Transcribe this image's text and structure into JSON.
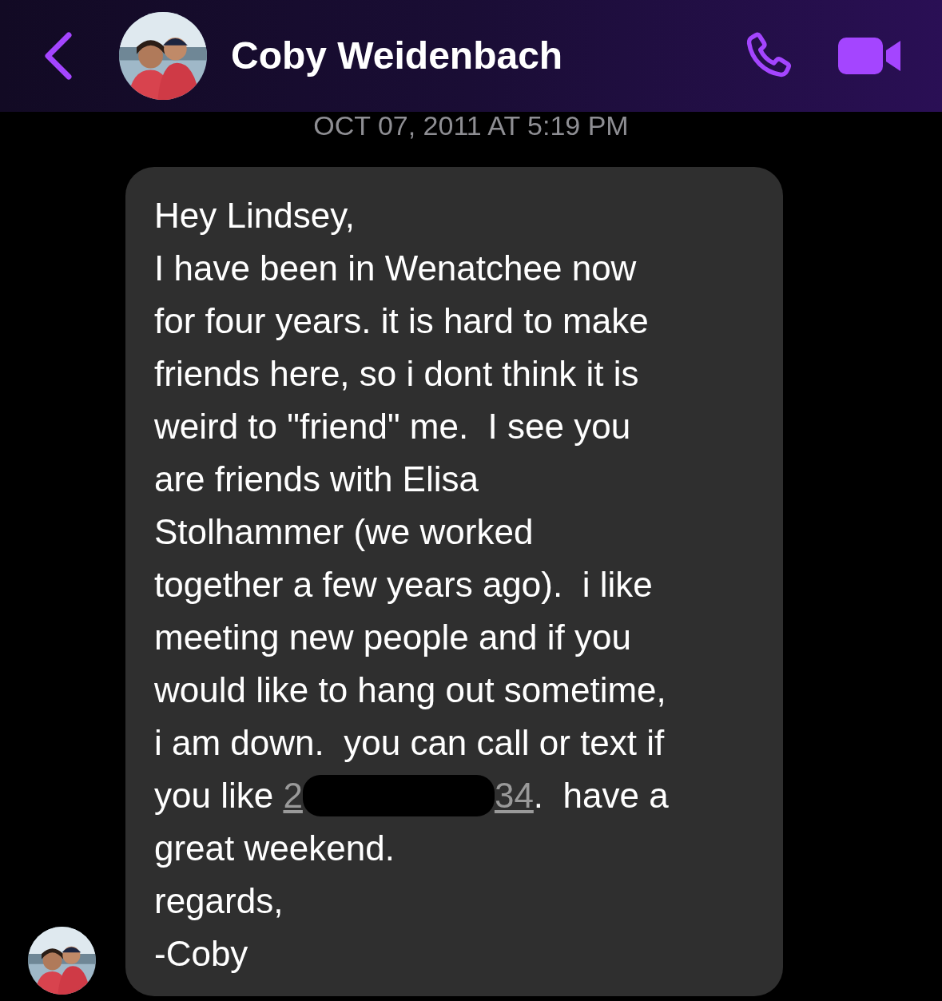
{
  "header": {
    "contact_name": "Coby Weidenbach"
  },
  "timestamp": "OCT 07, 2011 AT 5:19 PM",
  "message": {
    "lines": [
      {
        "kind": "text",
        "text": "Hey Lindsey,"
      },
      {
        "kind": "text",
        "text": "I have been in Wenatchee now"
      },
      {
        "kind": "text",
        "text": "for four years. it is hard to make"
      },
      {
        "kind": "text",
        "text": "friends here, so i dont think it is"
      },
      {
        "kind": "text",
        "text": "weird to \"friend\" me.  I see you"
      },
      {
        "kind": "text",
        "text": "are friends with Elisa"
      },
      {
        "kind": "text",
        "text": "Stolhammer (we worked"
      },
      {
        "kind": "text",
        "text": "together a few years ago).  i like"
      },
      {
        "kind": "text",
        "text": "meeting new people and if you"
      },
      {
        "kind": "text",
        "text": "would like to hang out sometime,"
      },
      {
        "kind": "text",
        "text": "i am down.  you can call or text if"
      },
      {
        "kind": "phone",
        "before": "you like ",
        "number_start": "2",
        "number_end": "34",
        "after": ".  have a"
      },
      {
        "kind": "text",
        "text": "great weekend."
      },
      {
        "kind": "text",
        "text": "regards,"
      },
      {
        "kind": "text",
        "text": "-Coby"
      }
    ]
  }
}
